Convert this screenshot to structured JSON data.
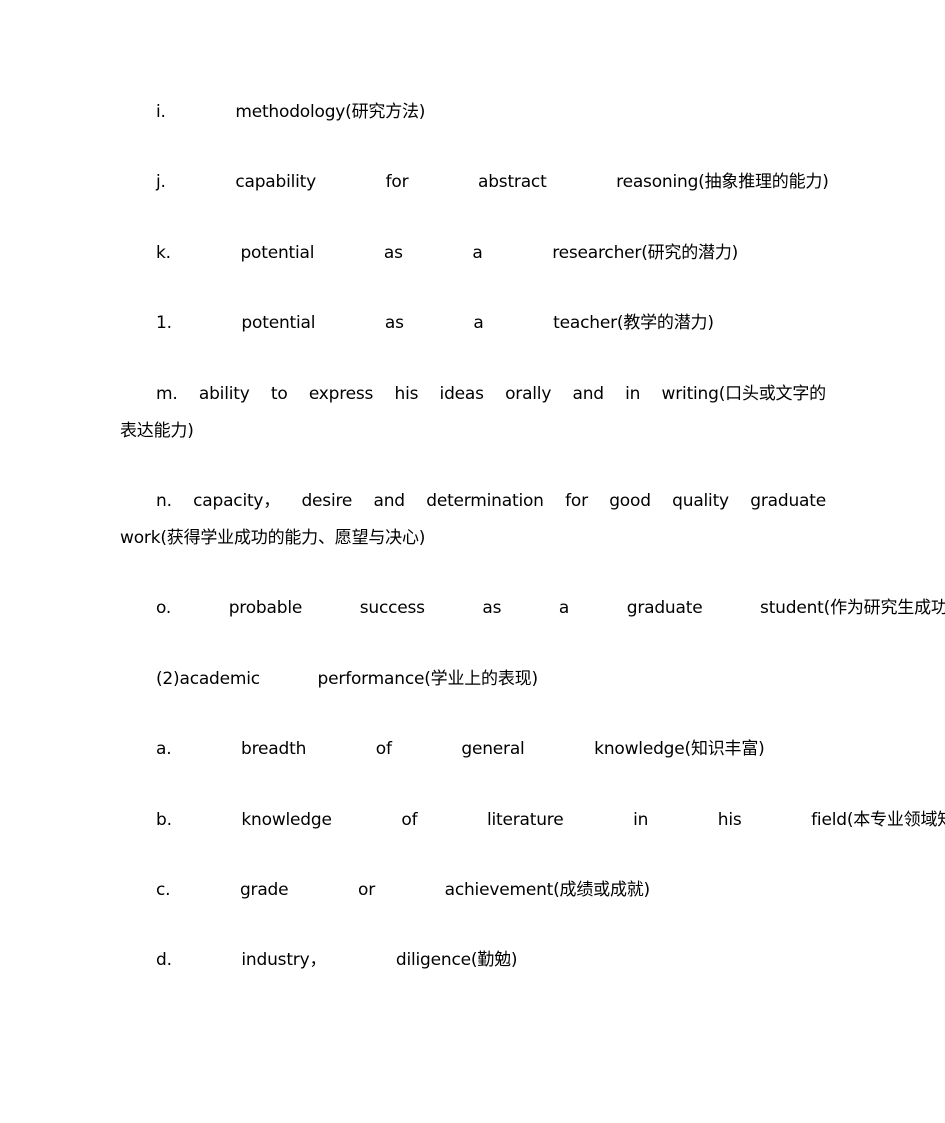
{
  "document": {
    "items": [
      {
        "id": "i",
        "text": "i.   methodology(研究方法)"
      },
      {
        "id": "j",
        "text": "j.   capability   for   abstract   reasoning(抽象推理的能力)"
      },
      {
        "id": "k",
        "text": "k.   potential   as   a   researcher(研究的潜力)"
      },
      {
        "id": "l",
        "text": "1.   potential   as   a   teacher(教学的潜力)"
      },
      {
        "id": "m",
        "words": [
          "m.",
          "ability",
          "to",
          "express",
          "his",
          "ideas",
          "orally",
          "and",
          "in",
          "writing(口头或文字的"
        ],
        "continuation": "表达能力)"
      },
      {
        "id": "n",
        "words": [
          "n.",
          "capacity，",
          "desire",
          "and",
          "determination",
          "for",
          "good",
          "quality",
          "graduate"
        ],
        "continuation": "work(获得学业成功的能力、愿望与决心)"
      },
      {
        "id": "o",
        "text": "o.   probable   success   as   a   graduate   student(作为研究生成功的可能性)"
      },
      {
        "id": "section2",
        "text": "(2)academic   performance(学业上的表现)"
      },
      {
        "id": "a",
        "text": "a.   breadth   of   general   knowledge(知识丰富)"
      },
      {
        "id": "b",
        "text": "b.   knowledge   of   literature   in   his   field(本专业领域知识)"
      },
      {
        "id": "c",
        "text": "c.   grade   or   achievement(成绩或成就)"
      },
      {
        "id": "d",
        "text": "d.   industry，   diligence(勤勉)"
      }
    ]
  }
}
